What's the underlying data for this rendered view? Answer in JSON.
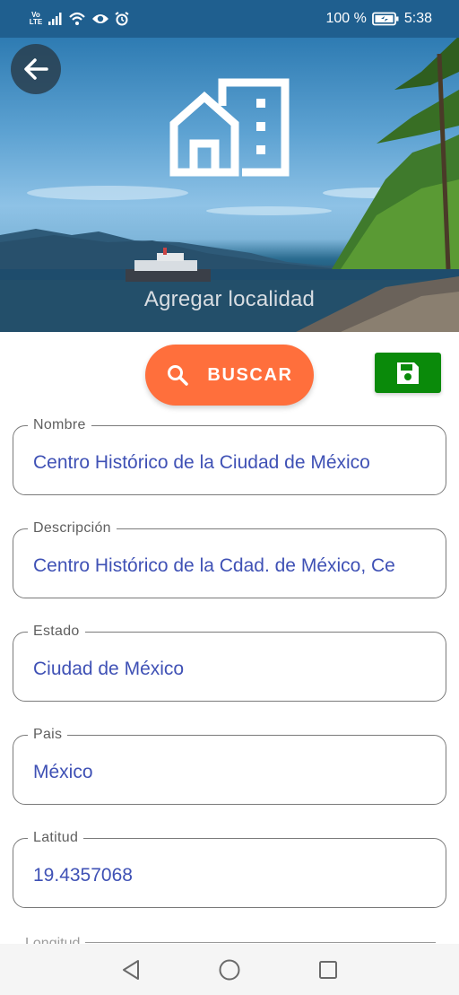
{
  "status_bar": {
    "volte_line1": "Vo",
    "volte_line2": "LTE",
    "battery_percent": "100 %",
    "time": "5:38"
  },
  "header": {
    "title": "Agregar localidad",
    "icon": "building-home-icon"
  },
  "actions": {
    "search_label": "BUSCAR",
    "search_icon": "search-icon",
    "save_icon": "save-icon",
    "search_color": "#ff6f3c",
    "save_color": "#0a8a0a"
  },
  "form": {
    "fields": [
      {
        "label": "Nombre",
        "value": "Centro Histórico de la Ciudad de México"
      },
      {
        "label": "Descripción",
        "value": "Centro Histórico de la Cdad. de México, Ce"
      },
      {
        "label": "Estado",
        "value": "Ciudad de México"
      },
      {
        "label": "Pais",
        "value": "México"
      },
      {
        "label": "Latitud",
        "value": "19.4357068"
      }
    ],
    "next_field_label": "Longitud"
  },
  "colors": {
    "value_text": "#3f51b5",
    "status_bar": "#1f5f8f"
  }
}
